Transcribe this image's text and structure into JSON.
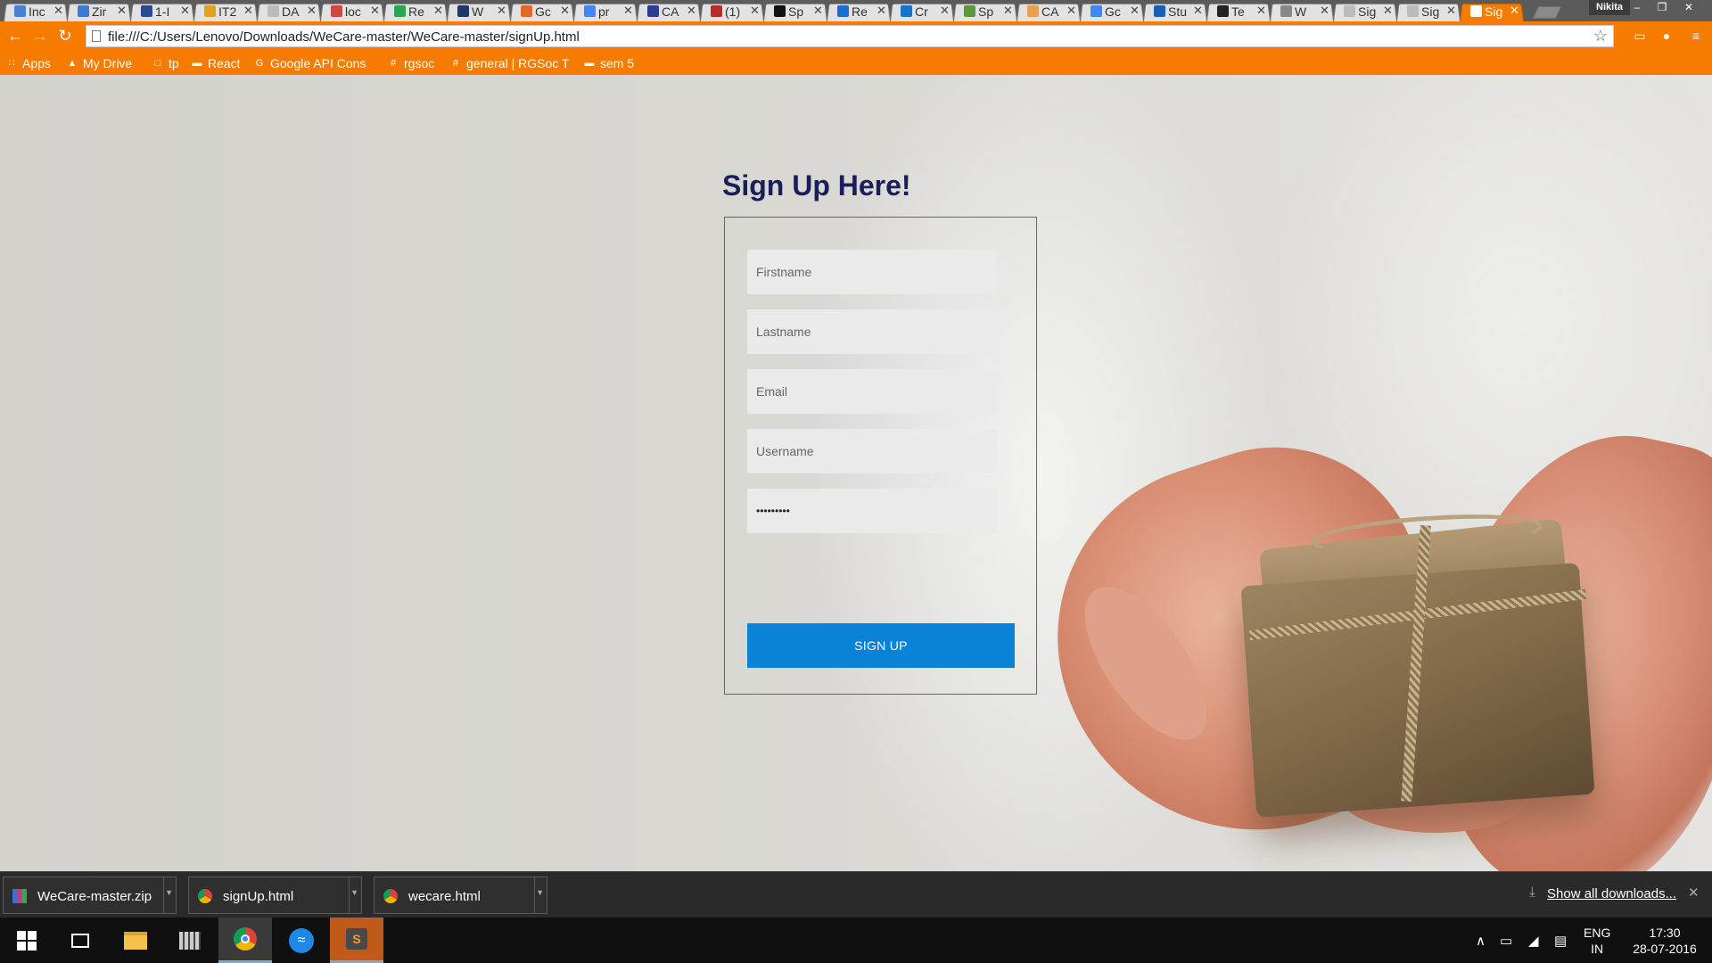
{
  "browser": {
    "tabs": [
      {
        "title": "Inc",
        "icon": "inbox-icon",
        "color": "#4a7fd1"
      },
      {
        "title": "Zir",
        "icon": "zirco-icon",
        "color": "#3c7ad6"
      },
      {
        "title": "1-I",
        "icon": "hackerrank-icon",
        "color": "#2d4b8c"
      },
      {
        "title": "IT2",
        "icon": "in-icon",
        "color": "#e0a020"
      },
      {
        "title": "DA",
        "icon": "blank-icon",
        "color": "#bbbbbb"
      },
      {
        "title": "loc",
        "icon": "gmail-icon",
        "color": "#d44638"
      },
      {
        "title": "Re",
        "icon": "hackerearth-icon",
        "color": "#2da44e"
      },
      {
        "title": "W",
        "icon": "wikipedia-icon",
        "color": "#1b3a6b"
      },
      {
        "title": "Gc",
        "icon": "gitlab-icon",
        "color": "#e2672b"
      },
      {
        "title": "pr",
        "icon": "google-icon",
        "color": "#4285f4"
      },
      {
        "title": "CA",
        "icon": "paragraph-icon",
        "color": "#2a3f8f"
      },
      {
        "title": "(1)",
        "icon": "quora-icon",
        "color": "#b92b27"
      },
      {
        "title": "Sp",
        "icon": "s-icon",
        "color": "#111111"
      },
      {
        "title": "Re",
        "icon": "ten-icon",
        "color": "#1c6dd0"
      },
      {
        "title": "Cr",
        "icon": "coursera-icon",
        "color": "#1a73c6"
      },
      {
        "title": "Sp",
        "icon": "spoken-icon",
        "color": "#5a9a3a"
      },
      {
        "title": "CA",
        "icon": "ca-icon",
        "color": "#e8a050"
      },
      {
        "title": "Gc",
        "icon": "google-icon",
        "color": "#4285f4"
      },
      {
        "title": "Stu",
        "icon": "studio-icon",
        "color": "#1d5fae"
      },
      {
        "title": "Te",
        "icon": "github-icon",
        "color": "#222222"
      },
      {
        "title": "W",
        "icon": "globe-icon",
        "color": "#888888"
      },
      {
        "title": "Sig",
        "icon": "blank-icon",
        "color": "#bbbbbb"
      },
      {
        "title": "Sig",
        "icon": "blank-icon",
        "color": "#bbbbbb"
      },
      {
        "title": "Sig",
        "icon": "page-icon",
        "color": "#ffffff",
        "active": true
      }
    ],
    "profile_name": "Nikita",
    "url": "file:///C:/Users/Lenovo/Downloads/WeCare-master/WeCare-master/signUp.html",
    "accent_color": "#f57c00"
  },
  "bookmarks": [
    {
      "label": "Apps",
      "icon": "apps-grid-icon"
    },
    {
      "label": "My Drive",
      "icon": "drive-icon"
    },
    {
      "label": "tp",
      "icon": "page-icon"
    },
    {
      "label": "React",
      "icon": "folder-icon"
    },
    {
      "label": "Google API Cons",
      "icon": "google-icon"
    },
    {
      "label": "rgsoc",
      "icon": "slack-icon"
    },
    {
      "label": "general | RGSoc T",
      "icon": "slack-icon"
    },
    {
      "label": "sem 5",
      "icon": "folder-icon"
    }
  ],
  "signup": {
    "title": "Sign Up Here!",
    "firstname_placeholder": "Firstname",
    "lastname_placeholder": "Lastname",
    "email_placeholder": "Email",
    "username_placeholder": "Username",
    "password_value": "•••••••••",
    "button_label": "SIGN UP",
    "button_color": "#0a82d6",
    "title_color": "#1a1f5c"
  },
  "downloads": {
    "items": [
      {
        "name": "WeCare-master.zip",
        "icon": "winrar-archive-icon"
      },
      {
        "name": "signUp.html",
        "icon": "chrome-icon"
      },
      {
        "name": "wecare.html",
        "icon": "chrome-icon"
      }
    ],
    "show_all_label": "Show all downloads..."
  },
  "taskbar": {
    "apps": [
      "windows-start-icon",
      "task-view-icon",
      "file-explorer-icon",
      "media-player-icon",
      "chrome-icon",
      "wifi-app-icon",
      "sublime-text-icon"
    ],
    "language_line1": "ENG",
    "language_line2": "IN",
    "time": "17:30",
    "date": "28-07-2016"
  }
}
